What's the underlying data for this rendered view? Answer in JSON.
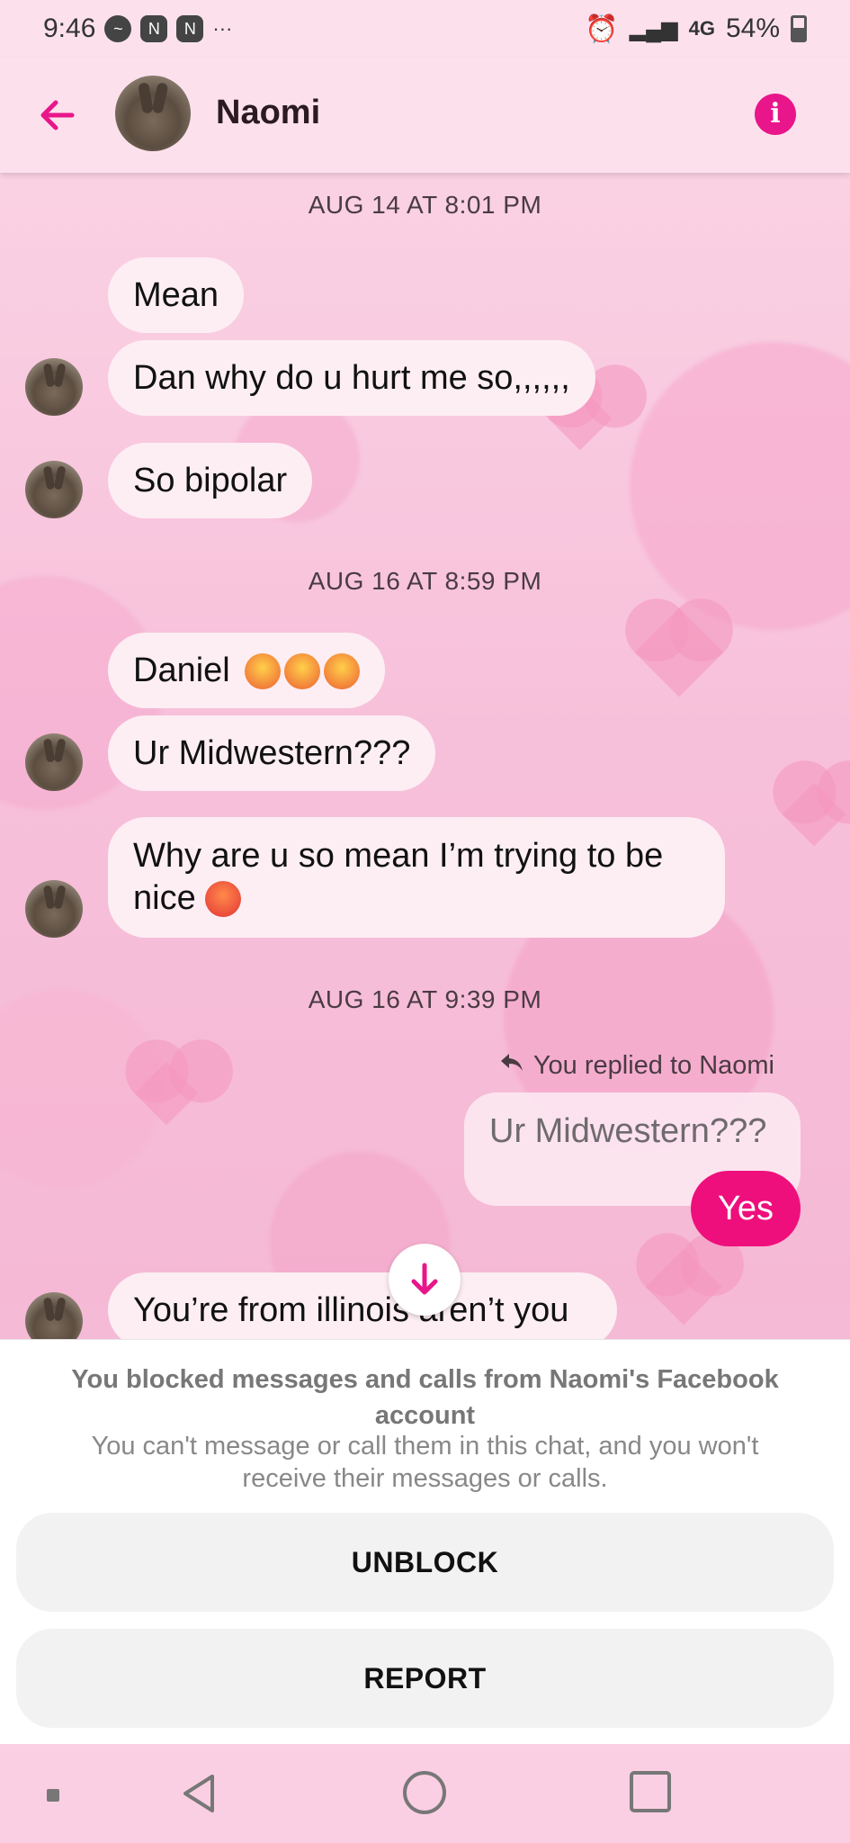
{
  "status_bar": {
    "time": "9:46",
    "battery": "54%",
    "network": "4G"
  },
  "header": {
    "contact_name": "Naomi",
    "back_icon": "arrow-left-icon",
    "info_icon": "info-icon"
  },
  "timestamps": [
    "AUG 14 AT 8:01 PM",
    "AUG 16 AT 8:59 PM",
    "AUG 16 AT 9:39 PM"
  ],
  "messages": {
    "m1": "Mean",
    "m2": "Dan why do u hurt me so,,,,,,",
    "m3": "So bipolar",
    "m4": "Daniel",
    "m5": "Ur Midwestern???",
    "m6_line1": "Why are u so mean I’m trying to be",
    "m6_line2": "nice",
    "m7": "You’re from illinois aren’t you"
  },
  "reply": {
    "note": "You replied to Naomi",
    "quoted": "Ur Midwestern???",
    "sent": "Yes"
  },
  "block_panel": {
    "title": "You blocked messages and calls from Naomi's Facebook account",
    "description": "You can't message or call them in this chat, and you won't receive their messages or calls.",
    "unblock_label": "UNBLOCK",
    "report_label": "REPORT"
  },
  "colors": {
    "accent": "#e8168a",
    "sent_bubble": "#ee0f7c",
    "received_bubble": "#fdeef3"
  }
}
